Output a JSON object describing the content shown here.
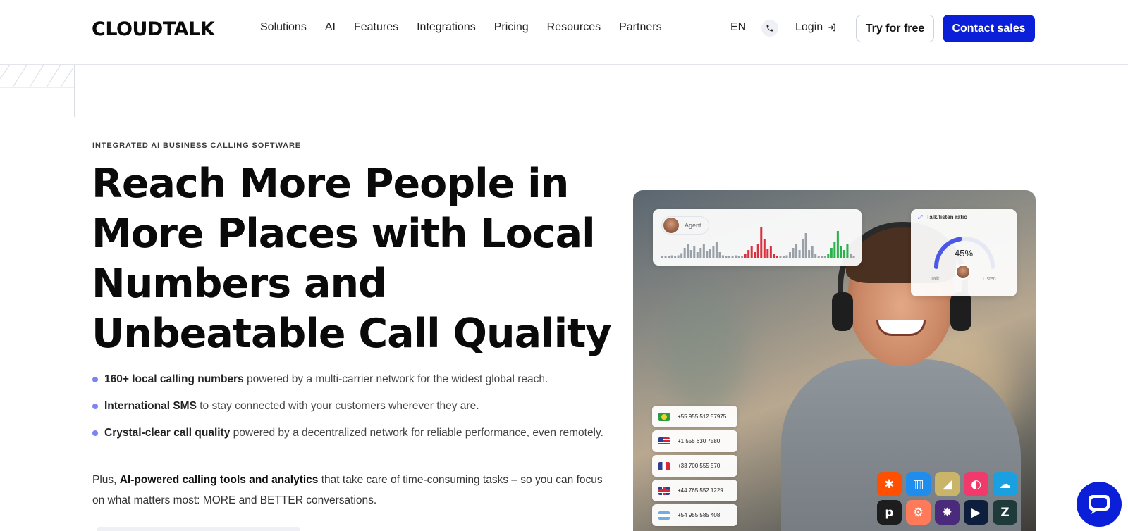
{
  "header": {
    "logo": "CLOUDTALK",
    "nav": [
      "Solutions",
      "AI",
      "Features",
      "Integrations",
      "Pricing",
      "Resources",
      "Partners"
    ],
    "lang": "EN",
    "login": "Login",
    "try_label": "Try for free",
    "contact_label": "Contact sales"
  },
  "hero": {
    "eyebrow": "INTEGRATED AI BUSINESS CALLING SOFTWARE",
    "headline": "Reach More People in More Places with Local Numbers and Unbeatable Call Quality",
    "bullets": [
      {
        "bold": "160+ local calling numbers",
        "rest": " powered by a multi-carrier network for the widest global reach."
      },
      {
        "bold": "International SMS",
        "rest": " to stay connected with your customers wherever they are."
      },
      {
        "bold": "Crystal-clear call quality",
        "rest": " powered by a decentralized network for reliable performance, even remotely."
      }
    ],
    "plus_prefix": "Plus, ",
    "plus_bold": "AI-powered calling tools and analytics",
    "plus_rest": " that take care of time-consuming tasks – so you can focus on what matters most: MORE and BETTER conversations."
  },
  "image_overlay": {
    "agent_label": "Agent",
    "ratio_title": "Talk/listen ratio",
    "ratio_value": "45%",
    "ratio_fraction": 0.45,
    "talk_label": "Talk",
    "listen_label": "Listen",
    "numbers": [
      {
        "flag": "br",
        "number": "+55 955 512 57975"
      },
      {
        "flag": "us",
        "number": "+1 555 630 7580"
      },
      {
        "flag": "fr",
        "number": "+33 700 555 570"
      },
      {
        "flag": "uk",
        "number": "+44 765 552 1229"
      },
      {
        "flag": "ar",
        "number": "+54 955 585 408"
      }
    ],
    "apps": [
      {
        "icon": "zapier-icon",
        "color": "#ff4f00",
        "glyph": "✱"
      },
      {
        "icon": "intercom-icon",
        "color": "#1f8ded",
        "glyph": "▥"
      },
      {
        "icon": "pipeline-icon",
        "color": "#c9b46a",
        "glyph": "◢"
      },
      {
        "icon": "front-icon",
        "color": "#f03a6b",
        "glyph": "◐"
      },
      {
        "icon": "salesforce-icon",
        "color": "#1aa0e0",
        "glyph": "☁"
      },
      {
        "icon": "pipedrive-icon",
        "color": "#1d1d1d",
        "glyph": "p"
      },
      {
        "icon": "hubspot-icon",
        "color": "#ff7a59",
        "glyph": "⚙"
      },
      {
        "icon": "gorgias-icon",
        "color": "#4a2a7a",
        "glyph": "✸"
      },
      {
        "icon": "dynamics-icon",
        "color": "#0d1f3c",
        "glyph": "▶"
      },
      {
        "icon": "zendesk-icon",
        "color": "#1f3a3a",
        "glyph": "Z"
      }
    ]
  },
  "colors": {
    "brand_blue": "#0b1fd8",
    "bullet": "#7b85f2"
  }
}
